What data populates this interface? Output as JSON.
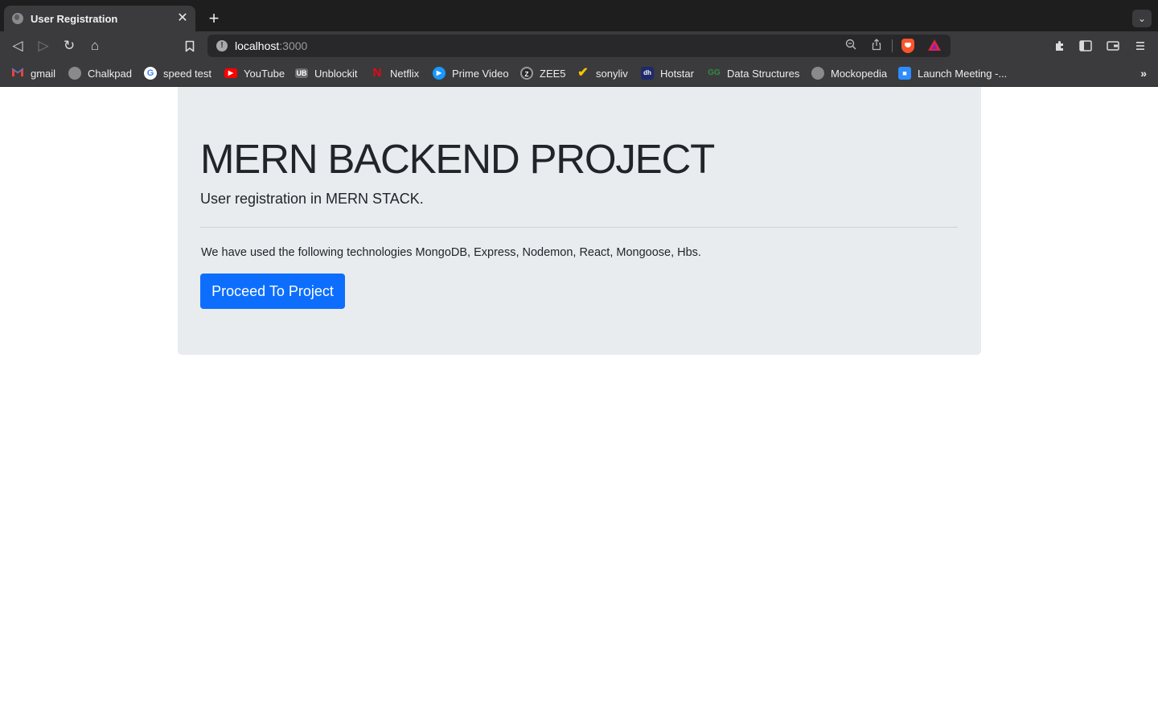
{
  "browser": {
    "tab": {
      "title": "User Registration",
      "favicon": "globe-icon",
      "close_glyph": "✕"
    },
    "newtab_glyph": "+",
    "address": {
      "host": "localhost",
      "port": ":3000"
    },
    "bookmarks": [
      {
        "label": "gmail",
        "icon": "gmail-icon"
      },
      {
        "label": "Chalkpad",
        "icon": "globe-icon"
      },
      {
        "label": "speed test",
        "icon": "google-icon"
      },
      {
        "label": "YouTube",
        "icon": "youtube-icon"
      },
      {
        "label": "Unblockit",
        "icon": "unblockit-icon"
      },
      {
        "label": "Netflix",
        "icon": "netflix-icon"
      },
      {
        "label": "Prime Video",
        "icon": "prime-video-icon"
      },
      {
        "label": "ZEE5",
        "icon": "zee5-icon"
      },
      {
        "label": "sonyliv",
        "icon": "sonyliv-icon"
      },
      {
        "label": "Hotstar",
        "icon": "hotstar-icon"
      },
      {
        "label": "Data Structures",
        "icon": "geeksforgeeks-icon"
      },
      {
        "label": "Mockopedia",
        "icon": "globe-icon"
      },
      {
        "label": "Launch Meeting -...",
        "icon": "zoom-icon"
      }
    ],
    "bookmarks_overflow": "»"
  },
  "page": {
    "title": "MERN BACKEND PROJECT",
    "subtitle": "User registration in MERN STACK.",
    "description": "We have used the following technologies MongoDB, Express, Nodemon, React, Mongoose, Hbs.",
    "button_label": "Proceed To Project"
  },
  "colors": {
    "jumbotron_bg": "#e9ecef",
    "primary_button": "#0d6efd",
    "chrome_toolbar": "#3b3b3d"
  }
}
